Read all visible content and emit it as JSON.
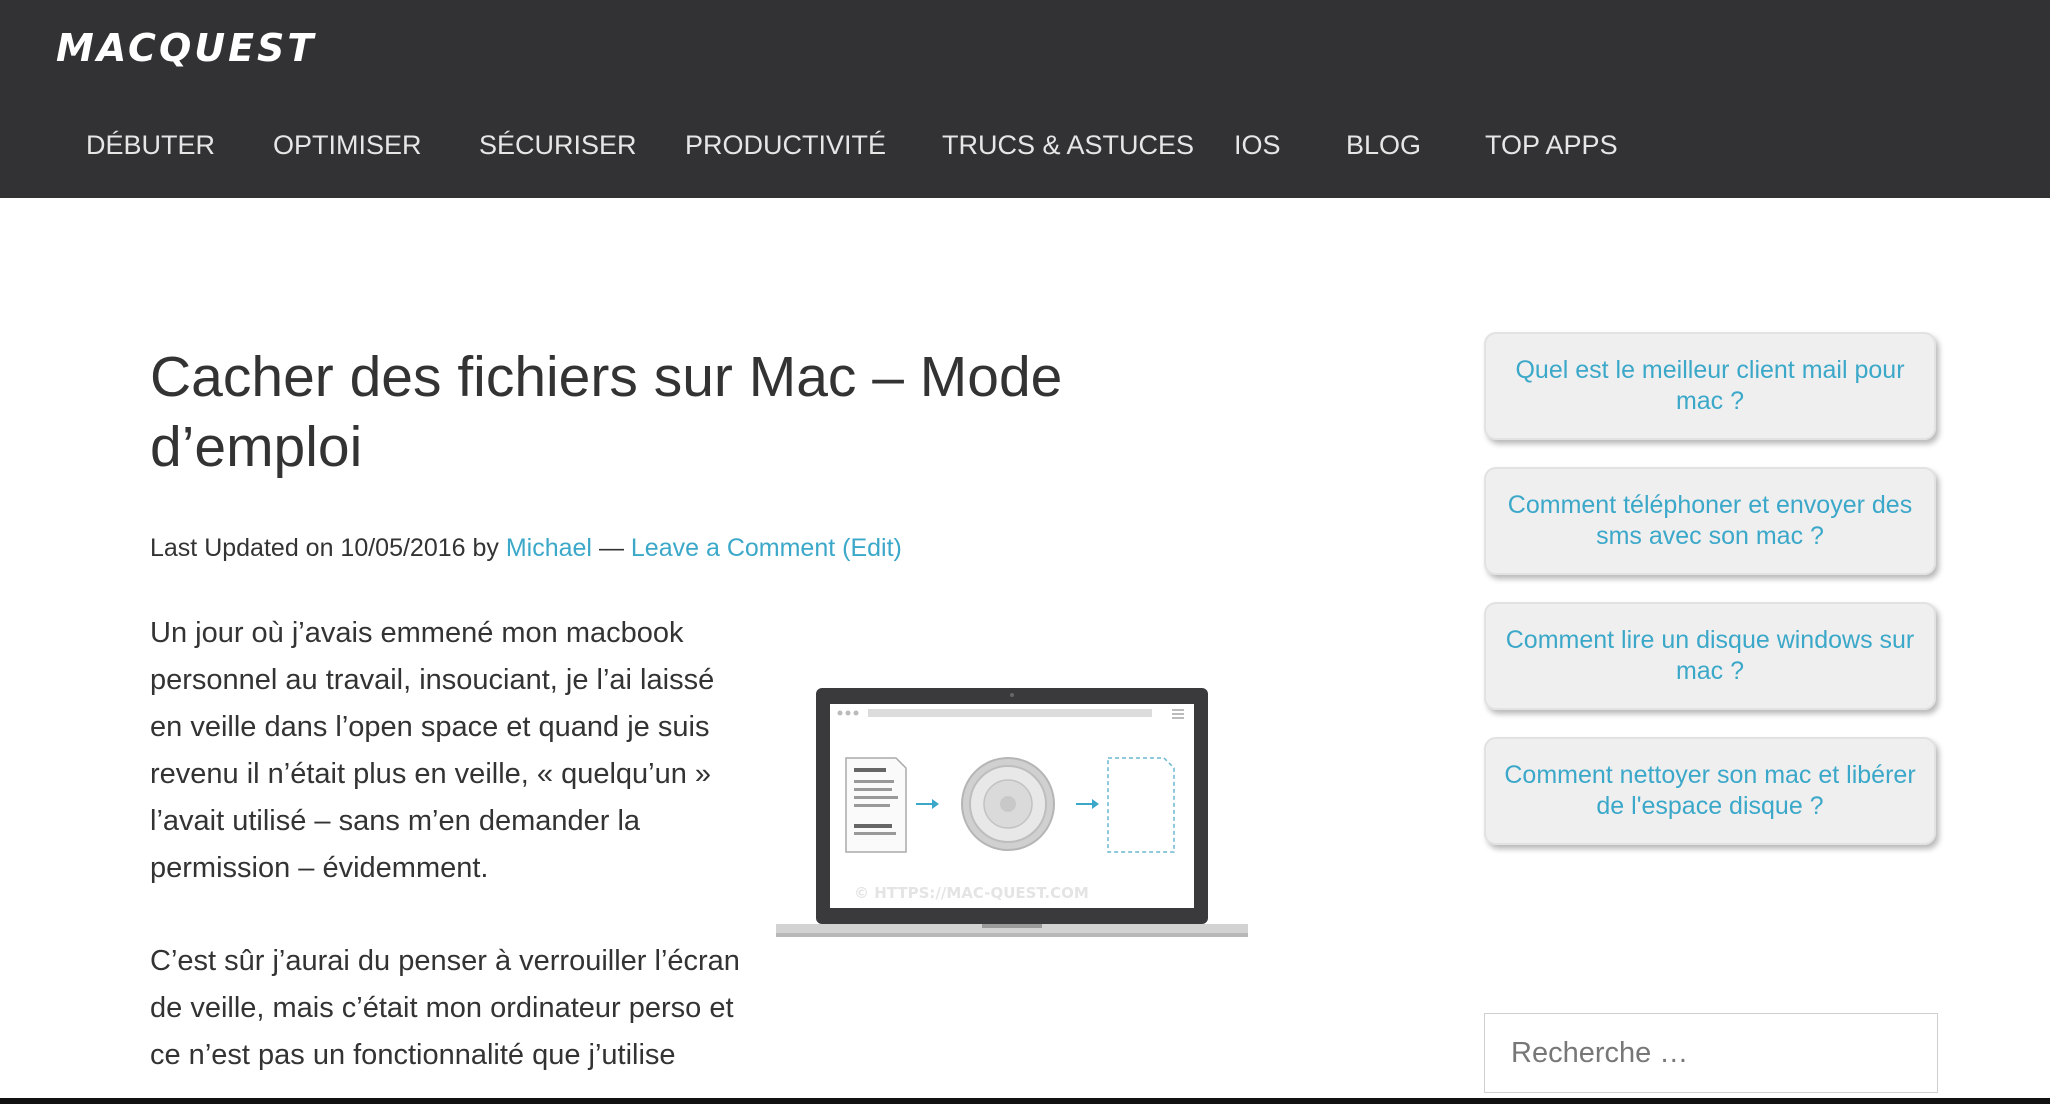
{
  "site": {
    "logo": "MACQUEST"
  },
  "nav": {
    "items": [
      {
        "label": "DÉBUTER"
      },
      {
        "label": "OPTIMISER"
      },
      {
        "label": "SÉCURISER"
      },
      {
        "label": "PRODUCTIVITÉ"
      },
      {
        "label": "TRUCS & ASTUCES"
      },
      {
        "label": "IOS"
      },
      {
        "label": "BLOG"
      },
      {
        "label": "TOP APPS"
      }
    ]
  },
  "article": {
    "title": "Cacher des fichiers sur Mac – Mode d’emploi",
    "meta": {
      "prefix": "Last Updated on 10/05/2016 by ",
      "author": "Michael",
      "separator": " — ",
      "comment": "Leave a Comment",
      "edit": "(Edit)"
    },
    "paragraphs": [
      "Un jour où j’avais emmené mon macbook personnel au travail, insouciant, je l’ai laissé en veille dans l’open space et quand je suis revenu il n’était plus en veille, « quelqu’un » l’avait utilisé – sans m’en demander la permission – évidemment.",
      "C’est sûr j’aurai du penser à verrouiller l’écran de veille, mais c’était  mon ordinateur perso et ce n’est pas un fonctionnalité que j’utilise"
    ],
    "image": {
      "watermark": "© HTTPS://MAC-QUEST.COM"
    }
  },
  "sidebar": {
    "related": [
      {
        "label": "Quel est le meilleur client mail pour mac ?"
      },
      {
        "label": "Comment téléphoner et envoyer des sms avec son mac ?"
      },
      {
        "label": "Comment lire un disque windows sur mac ?"
      },
      {
        "label": "Comment nettoyer son mac et libérer de l'espace disque ?"
      }
    ],
    "search": {
      "placeholder": "Recherche …"
    }
  },
  "colors": {
    "header_bg": "#323234",
    "link": "#3ba8c9",
    "card_bg": "#efefef"
  },
  "icons": [
    "document-icon",
    "arrow-right-icon",
    "safe-dial-icon",
    "dashed-file-icon"
  ]
}
